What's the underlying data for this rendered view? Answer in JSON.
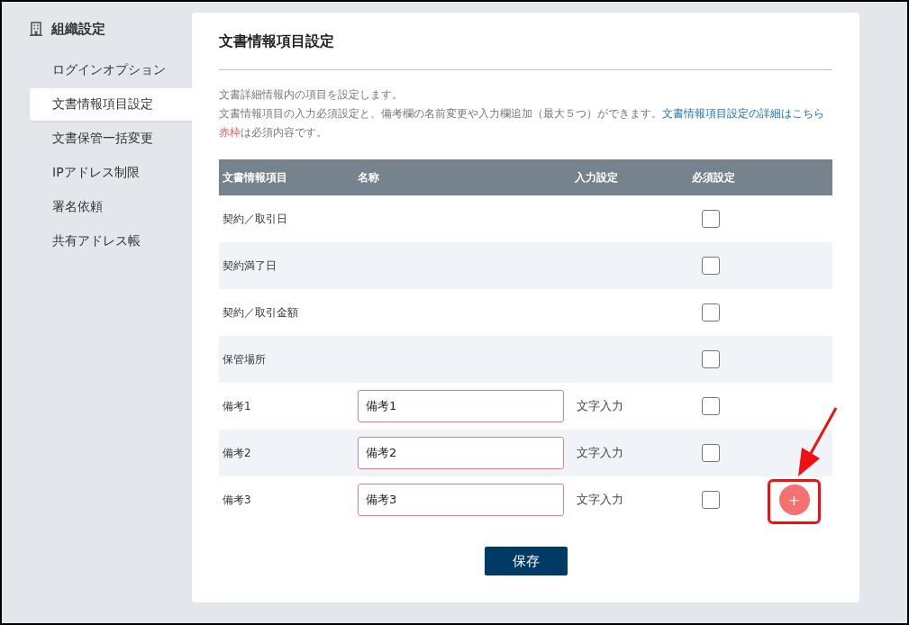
{
  "sidebar": {
    "title": "組織設定",
    "items": [
      {
        "label": "ログインオプション",
        "selected": false
      },
      {
        "label": "文書情報項目設定",
        "selected": true
      },
      {
        "label": "文書保管一括変更",
        "selected": false
      },
      {
        "label": "IPアドレス制限",
        "selected": false
      },
      {
        "label": "署名依頼",
        "selected": false
      },
      {
        "label": "共有アドレス帳",
        "selected": false
      }
    ]
  },
  "main": {
    "title": "文書情報項目設定",
    "description": {
      "line_1": "文書詳細情報内の項目を設定します。",
      "line_2": "文書情報項目の入力必須設定と、備考欄の名前変更や入力欄追加（最大５つ）ができます。",
      "link": "文書情報項目設定の詳細はこちら",
      "note_highlight": "赤枠",
      "note_rest": "は必須内容です。"
    },
    "table": {
      "columns": [
        "文書情報項目",
        "名称",
        "入力設定",
        "必須設定"
      ],
      "rows": [
        {
          "kind": "fixed",
          "item": "契約／取引日",
          "required": false
        },
        {
          "kind": "fixed",
          "item": "契約満了日",
          "required": false
        },
        {
          "kind": "fixed",
          "item": "契約／取引金額",
          "required": false
        },
        {
          "kind": "fixed",
          "item": "保管場所",
          "required": false
        },
        {
          "kind": "remark",
          "item": "備考1",
          "name": "備考1",
          "input_setting": "文字入力",
          "required": false
        },
        {
          "kind": "remark",
          "item": "備考2",
          "name": "備考2",
          "input_setting": "文字入力",
          "required": false
        },
        {
          "kind": "remark",
          "item": "備考3",
          "name": "備考3",
          "input_setting": "文字入力",
          "required": false,
          "add_button": "+"
        }
      ]
    },
    "save_button": "保存",
    "callout": true
  }
}
